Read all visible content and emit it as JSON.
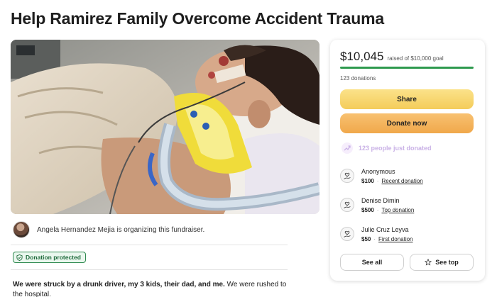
{
  "page": {
    "title": "Help Ramirez Family Overcome Accident Trauma"
  },
  "organizer": {
    "text": "Angela Hernandez Mejia is organizing this fundraiser."
  },
  "badge": {
    "label": "Donation protected"
  },
  "story": {
    "bold": "We were struck by a drunk driver, my 3 kids, their dad, and me.",
    "rest": " We were rushed to the hospital."
  },
  "sidebar": {
    "raised": "$10,045",
    "goal_text": "raised of $10,000 goal",
    "progress_fraction": 1.0,
    "donation_count": "123 donations",
    "share_label": "Share",
    "donate_label": "Donate now",
    "recent_text": "123 people just donated",
    "donors": [
      {
        "name": "Anonymous",
        "amount": "$100",
        "tag": "Recent donation"
      },
      {
        "name": "Denise Dimin",
        "amount": "$500",
        "tag": "Top donation"
      },
      {
        "name": "Julie Cruz Leyva",
        "amount": "$50",
        "tag": "First donation"
      }
    ],
    "see_all_label": "See all",
    "see_top_label": "See top"
  },
  "colors": {
    "progress": "#2f9a4f",
    "share_button": "#f4cc5a",
    "donate_button": "#f0a84b",
    "protected_badge": "#2e8a4f"
  },
  "icons": [
    "shield-icon",
    "trend-icon",
    "heart-hand-icon",
    "star-icon"
  ]
}
